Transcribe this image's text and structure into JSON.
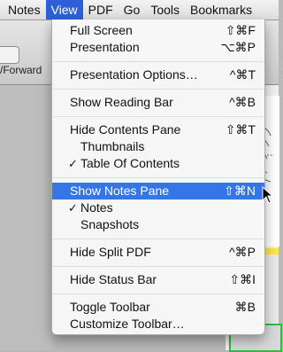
{
  "menubar": {
    "items": [
      "Notes",
      "View",
      "PDF",
      "Go",
      "Tools",
      "Bookmarks"
    ]
  },
  "background": {
    "nav_label": "/Forward"
  },
  "view_menu": {
    "items": [
      {
        "label": "Full Screen",
        "shortcut": "⇧⌘F"
      },
      {
        "label": "Presentation",
        "shortcut": "⌥⌘P"
      },
      {
        "label": "Presentation Options…",
        "shortcut": "^⌘T"
      },
      {
        "label": "Show Reading Bar",
        "shortcut": "^⌘B"
      },
      {
        "label": "Hide Contents Pane",
        "shortcut": "⇧⌘T"
      },
      {
        "label": "Thumbnails",
        "shortcut": ""
      },
      {
        "label": "Table Of Contents",
        "shortcut": "",
        "checked": true
      },
      {
        "label": "Show Notes Pane",
        "shortcut": "⇧⌘N",
        "highlighted": true
      },
      {
        "label": "Notes",
        "shortcut": "",
        "checked": true
      },
      {
        "label": "Snapshots",
        "shortcut": ""
      },
      {
        "label": "Hide Split PDF",
        "shortcut": "^⌘P"
      },
      {
        "label": "Hide Status Bar",
        "shortcut": "⇧⌘I"
      },
      {
        "label": "Toggle Toolbar",
        "shortcut": "⌘B"
      },
      {
        "label": "Customize Toolbar…",
        "shortcut": ""
      }
    ],
    "check_mark": "✓"
  }
}
